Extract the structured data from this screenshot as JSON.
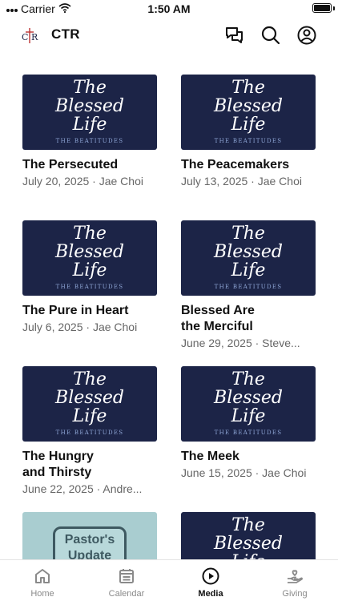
{
  "status_bar": {
    "carrier": "Carrier",
    "time": "1:50 AM"
  },
  "header": {
    "title": "CTR",
    "logo_text": "CTR"
  },
  "thumbnail": {
    "line1": "The",
    "line2": "Blessed",
    "line3": "Life",
    "series": "THE BEATITUDES"
  },
  "pastor_thumbnail": {
    "line1": "Pastor's",
    "line2": "Update"
  },
  "media": [
    {
      "title": "The Persecuted",
      "meta": "July 20, 2025 · Jae Choi"
    },
    {
      "title": "The Peacemakers",
      "meta": "July 13, 2025 · Jae Choi"
    },
    {
      "title": "The Pure in Heart",
      "meta": "July 6, 2025 · Jae Choi"
    },
    {
      "title": "Blessed Are\nthe Merciful",
      "meta": "June 29, 2025 · Steve..."
    },
    {
      "title": "The Hungry\nand Thirsty",
      "meta": "June 22, 2025 · Andre..."
    },
    {
      "title": "The Meek",
      "meta": "June 15, 2025 · Jae Choi"
    }
  ],
  "tabs": [
    {
      "label": "Home",
      "icon": "home-icon"
    },
    {
      "label": "Calendar",
      "icon": "calendar-icon"
    },
    {
      "label": "Media",
      "icon": "play-circle-icon",
      "active": true
    },
    {
      "label": "Giving",
      "icon": "giving-hand-icon"
    }
  ],
  "colors": {
    "thumbnail_bg": "#1c2447",
    "series_text": "#8fa6d6",
    "pastor_bg": "#a9cdd0",
    "active_tab": "#111111",
    "inactive_tab": "#8a8a8a"
  }
}
